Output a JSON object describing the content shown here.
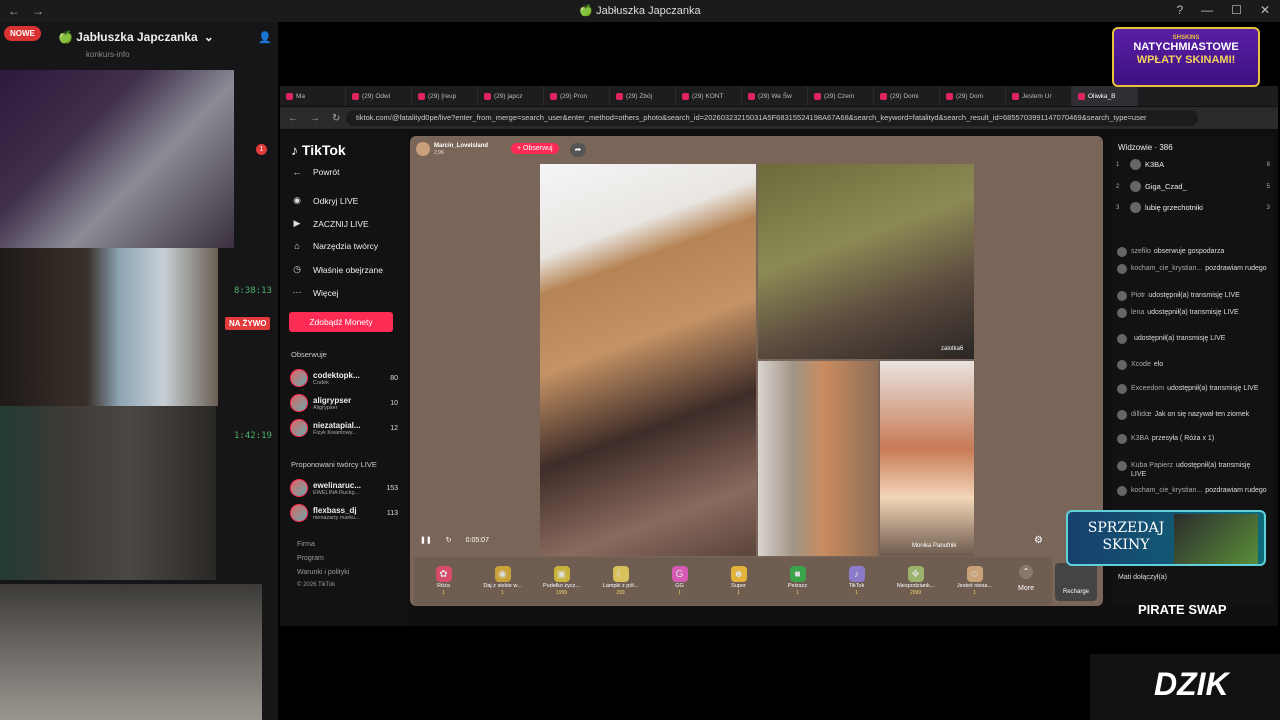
{
  "window": {
    "title": "🍏 Jabłuszka Japczanka"
  },
  "discord": {
    "badge_new": "NOWE",
    "server_name": "🍏 Jabłuszka Japczanka",
    "channel": "konkurs-info",
    "timer1": "8:38:13",
    "timer2": "1:42:19",
    "live_badge": "NA ŻYWO",
    "notif_count": "1"
  },
  "browser": {
    "tabs": [
      "Ma",
      "(29) Odwi",
      "(29) [reup",
      "(29) japcz",
      "(29) Pron",
      "(29) Zbój",
      "(29) KONT",
      "(29) We Św",
      "(29) Czem",
      "(29) Domi",
      "(29) Dom",
      "Jestem Ur",
      "Oliwka_B"
    ],
    "url": "tiktok.com/@fatalityd0pe/live?enter_from_merge=search_user&enter_method=others_photo&search_id=20260323215031A5F68315524198A67A68&search_keyword=fatalityd&search_result_id=6855703991147070469&search_type=user"
  },
  "tiktok": {
    "logo": "TikTok",
    "back": "Powrót",
    "nav": [
      "Odkryj LIVE",
      "ZACZNIJ LIVE",
      "Narzędzia twórcy",
      "Właśnie obejrzane",
      "Więcej"
    ],
    "coins_button": "Zdobądź Monety",
    "following_header": "Obserwuje",
    "following": [
      {
        "name": "codektopk...",
        "sub": "Codek",
        "count": "80"
      },
      {
        "name": "aligrypser",
        "sub": "Aligrypser",
        "count": "10"
      },
      {
        "name": "niezatapial...",
        "sub": "Fizyk Kwantowy...",
        "count": "12"
      }
    ],
    "suggested_header": "Proponowani twórcy LIVE",
    "suggested": [
      {
        "name": "ewelinaruc...",
        "sub": "EWELINA Ruckg...",
        "count": "153"
      },
      {
        "name": "flexbass_dj",
        "sub": "nienażarty marku...",
        "count": "113"
      }
    ],
    "footer": [
      "Firma",
      "Program",
      "Warunki i polityki",
      "© 2026 TikTok"
    ]
  },
  "live": {
    "host_name": "Marcin_Lovelsland",
    "host_count": "2,9K",
    "follow": "+ Obserwuj",
    "tag_top_right": "zalotka6",
    "tag_bottom": "Monika Panufnik",
    "time": "0:05:07",
    "gifts": [
      {
        "label": "Róża",
        "price": "1",
        "color": "#d64a6a",
        "glyph": "✿"
      },
      {
        "label": "Daj z siebie w...",
        "price": "1",
        "color": "#c9a23a",
        "glyph": "◉"
      },
      {
        "label": "Pudełko życz...",
        "price": "1999",
        "color": "#c9b23a",
        "glyph": "▣"
      },
      {
        "label": "Lampki z pół...",
        "price": "299",
        "color": "#d8c05a",
        "glyph": "☾"
      },
      {
        "label": "GG",
        "price": "1",
        "color": "#d75ab5",
        "glyph": "G"
      },
      {
        "label": "Super",
        "price": "1",
        "color": "#e2b23a",
        "glyph": "☻"
      },
      {
        "label": "Pełzacz",
        "price": "1",
        "color": "#3ba34a",
        "glyph": "■"
      },
      {
        "label": "TikTok",
        "price": "1",
        "color": "#8a7ac9",
        "glyph": "♪"
      },
      {
        "label": "Niespodziank...",
        "price": "2999",
        "color": "#9ab36a",
        "glyph": "❖"
      },
      {
        "label": "Jesteś niesa...",
        "price": "1",
        "color": "#c9a27a",
        "glyph": "☺"
      }
    ],
    "more": "More",
    "recharge": "Recharge"
  },
  "viewers": {
    "header": "Widzowie · 386",
    "top": [
      {
        "rank": "1",
        "name": "K3BA",
        "n": "8"
      },
      {
        "rank": "2",
        "name": "Giga_Czad_",
        "n": "5"
      },
      {
        "rank": "3",
        "name": "lubię grzechotniki",
        "n": "3"
      }
    ],
    "comments": [
      {
        "user": "szefilo",
        "text": "obserwuje gospodarza"
      },
      {
        "user": "kocham_cie_krystian...",
        "text": "pozdrawiam rudego"
      },
      {
        "user": "Piotr",
        "text": "udostępnił(a) transmisję LIVE"
      },
      {
        "user": "lena",
        "text": "udostępnił(a) transmisję LIVE"
      },
      {
        "user": "",
        "text": "udostępnił(a) transmisję LIVE"
      },
      {
        "user": "Xcode",
        "text": "elo"
      },
      {
        "user": "Exceedom",
        "text": "udostępnił(a) transmisję LIVE"
      },
      {
        "user": "dillidœ",
        "text": "Jak on się nazywał ten ziomek"
      },
      {
        "user": "K3BA",
        "text": "przesyła ( Róża x 1)"
      },
      {
        "user": "Kuba Papierz",
        "text": "udostępnił(a) transmisję LIVE"
      },
      {
        "user": "kocham_cie_krystian...",
        "text": "pozdrawiam rudego"
      }
    ],
    "joined": "Mati  dołączył(a)"
  },
  "ads": {
    "skins_small": "SHSKINS",
    "skins_line1": "NATYCHMIASTOWE",
    "skins_line2": "WPŁATY SKINAMI!",
    "sell": "SPRZEDAJ SKINY",
    "pirate": "PIRATE SWAP",
    "dzik": "DZIK"
  }
}
